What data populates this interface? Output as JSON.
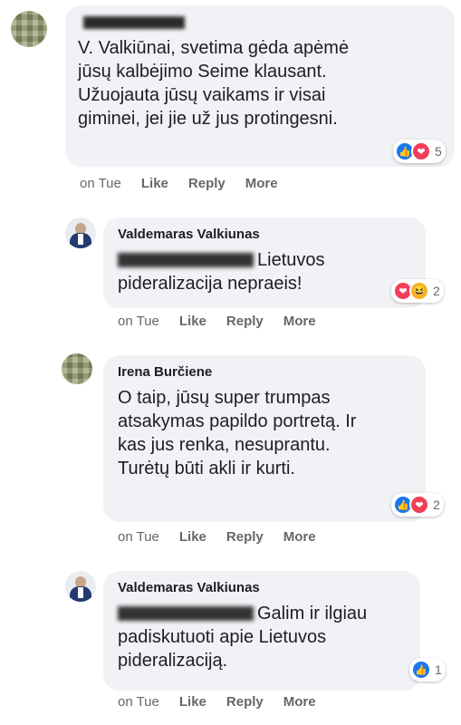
{
  "comments": [
    {
      "author_name_redacted": true,
      "text": "V. Valkiūnai, svetima gėda apėmė jūsų kalbėjimo Seime klausant. Užuojauta jūsų vaikams ir visai giminei, jei jie už jus protingesni.",
      "reactions": {
        "icons": [
          "like-icon",
          "love-icon"
        ],
        "count": "5"
      },
      "actions": {
        "time": "on Tue",
        "like": "Like",
        "reply": "Reply",
        "more": "More"
      }
    },
    {
      "author_name": "Valdemaras Valkiunas",
      "text": "Lietuvos pideralizacija nepraeis!",
      "reactions": {
        "icons": [
          "love-icon",
          "haha-icon"
        ],
        "count": "2"
      },
      "actions": {
        "time": "on Tue",
        "like": "Like",
        "reply": "Reply",
        "more": "More"
      }
    },
    {
      "author_name": "Irena Burčiene",
      "text": "O taip, jūsų super trumpas atsakymas papildo portretą. Ir kas jus renka, nesuprantu. Turėtų būti akli ir kurti.",
      "reactions": {
        "icons": [
          "like-icon",
          "love-icon"
        ],
        "count": "2"
      },
      "actions": {
        "time": "on Tue",
        "like": "Like",
        "reply": "Reply",
        "more": "More"
      }
    },
    {
      "author_name": "Valdemaras Valkiunas",
      "text": "Galim ir ilgiau padiskutuoti apie Lietuvos pideralizaciją.",
      "reactions": {
        "icons": [
          "like-icon"
        ],
        "count": "1"
      },
      "actions": {
        "time": "on Tue",
        "like": "Like",
        "reply": "Reply",
        "more": "More"
      }
    }
  ],
  "colors": {
    "bubble": "#f0f2f5",
    "like": "#1877f2",
    "love": "#f33e58",
    "haha": "#f7b125",
    "muted_text": "#65676b"
  }
}
